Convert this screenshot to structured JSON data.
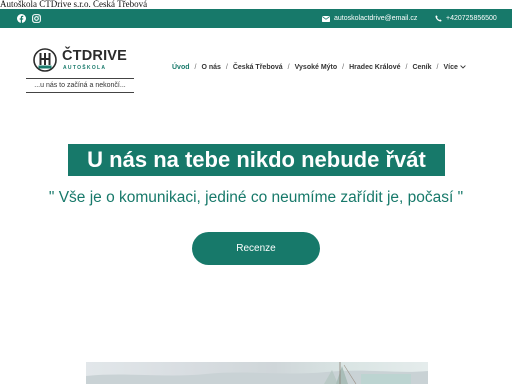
{
  "document_title": "Autoškola ČTDrive s.r.o. Česká Třebová",
  "topbar": {
    "background": "#17796a",
    "socials": [
      {
        "icon": "facebook-icon"
      },
      {
        "icon": "instagram-icon"
      }
    ],
    "email": "autoskolactdrive@email.cz",
    "phone": "+420725856500"
  },
  "brand": {
    "logo_word": "ČTDRIVE",
    "logo_sub": "AUTOŠKOLA",
    "slogan": "...u nás to začíná a nekončí..."
  },
  "nav": {
    "items": [
      {
        "label": "Úvod",
        "active": true
      },
      {
        "label": "O nás",
        "active": false
      },
      {
        "label": "Česká Třebová",
        "active": false
      },
      {
        "label": "Vysoké Mýto",
        "active": false
      },
      {
        "label": "Hradec Králové",
        "active": false
      },
      {
        "label": "Ceník",
        "active": false
      },
      {
        "label": "Více",
        "active": false,
        "dropdown": true
      }
    ]
  },
  "hero": {
    "title": "U nás na tebe nikdo nebude řvát",
    "quote": "\" Vše je o komunikaci, jediné co neumíme zařídit je, počasí \"",
    "button_label": "Recenze"
  },
  "colors": {
    "accent": "#17796a",
    "text": "#333333",
    "background": "#ffffff"
  }
}
